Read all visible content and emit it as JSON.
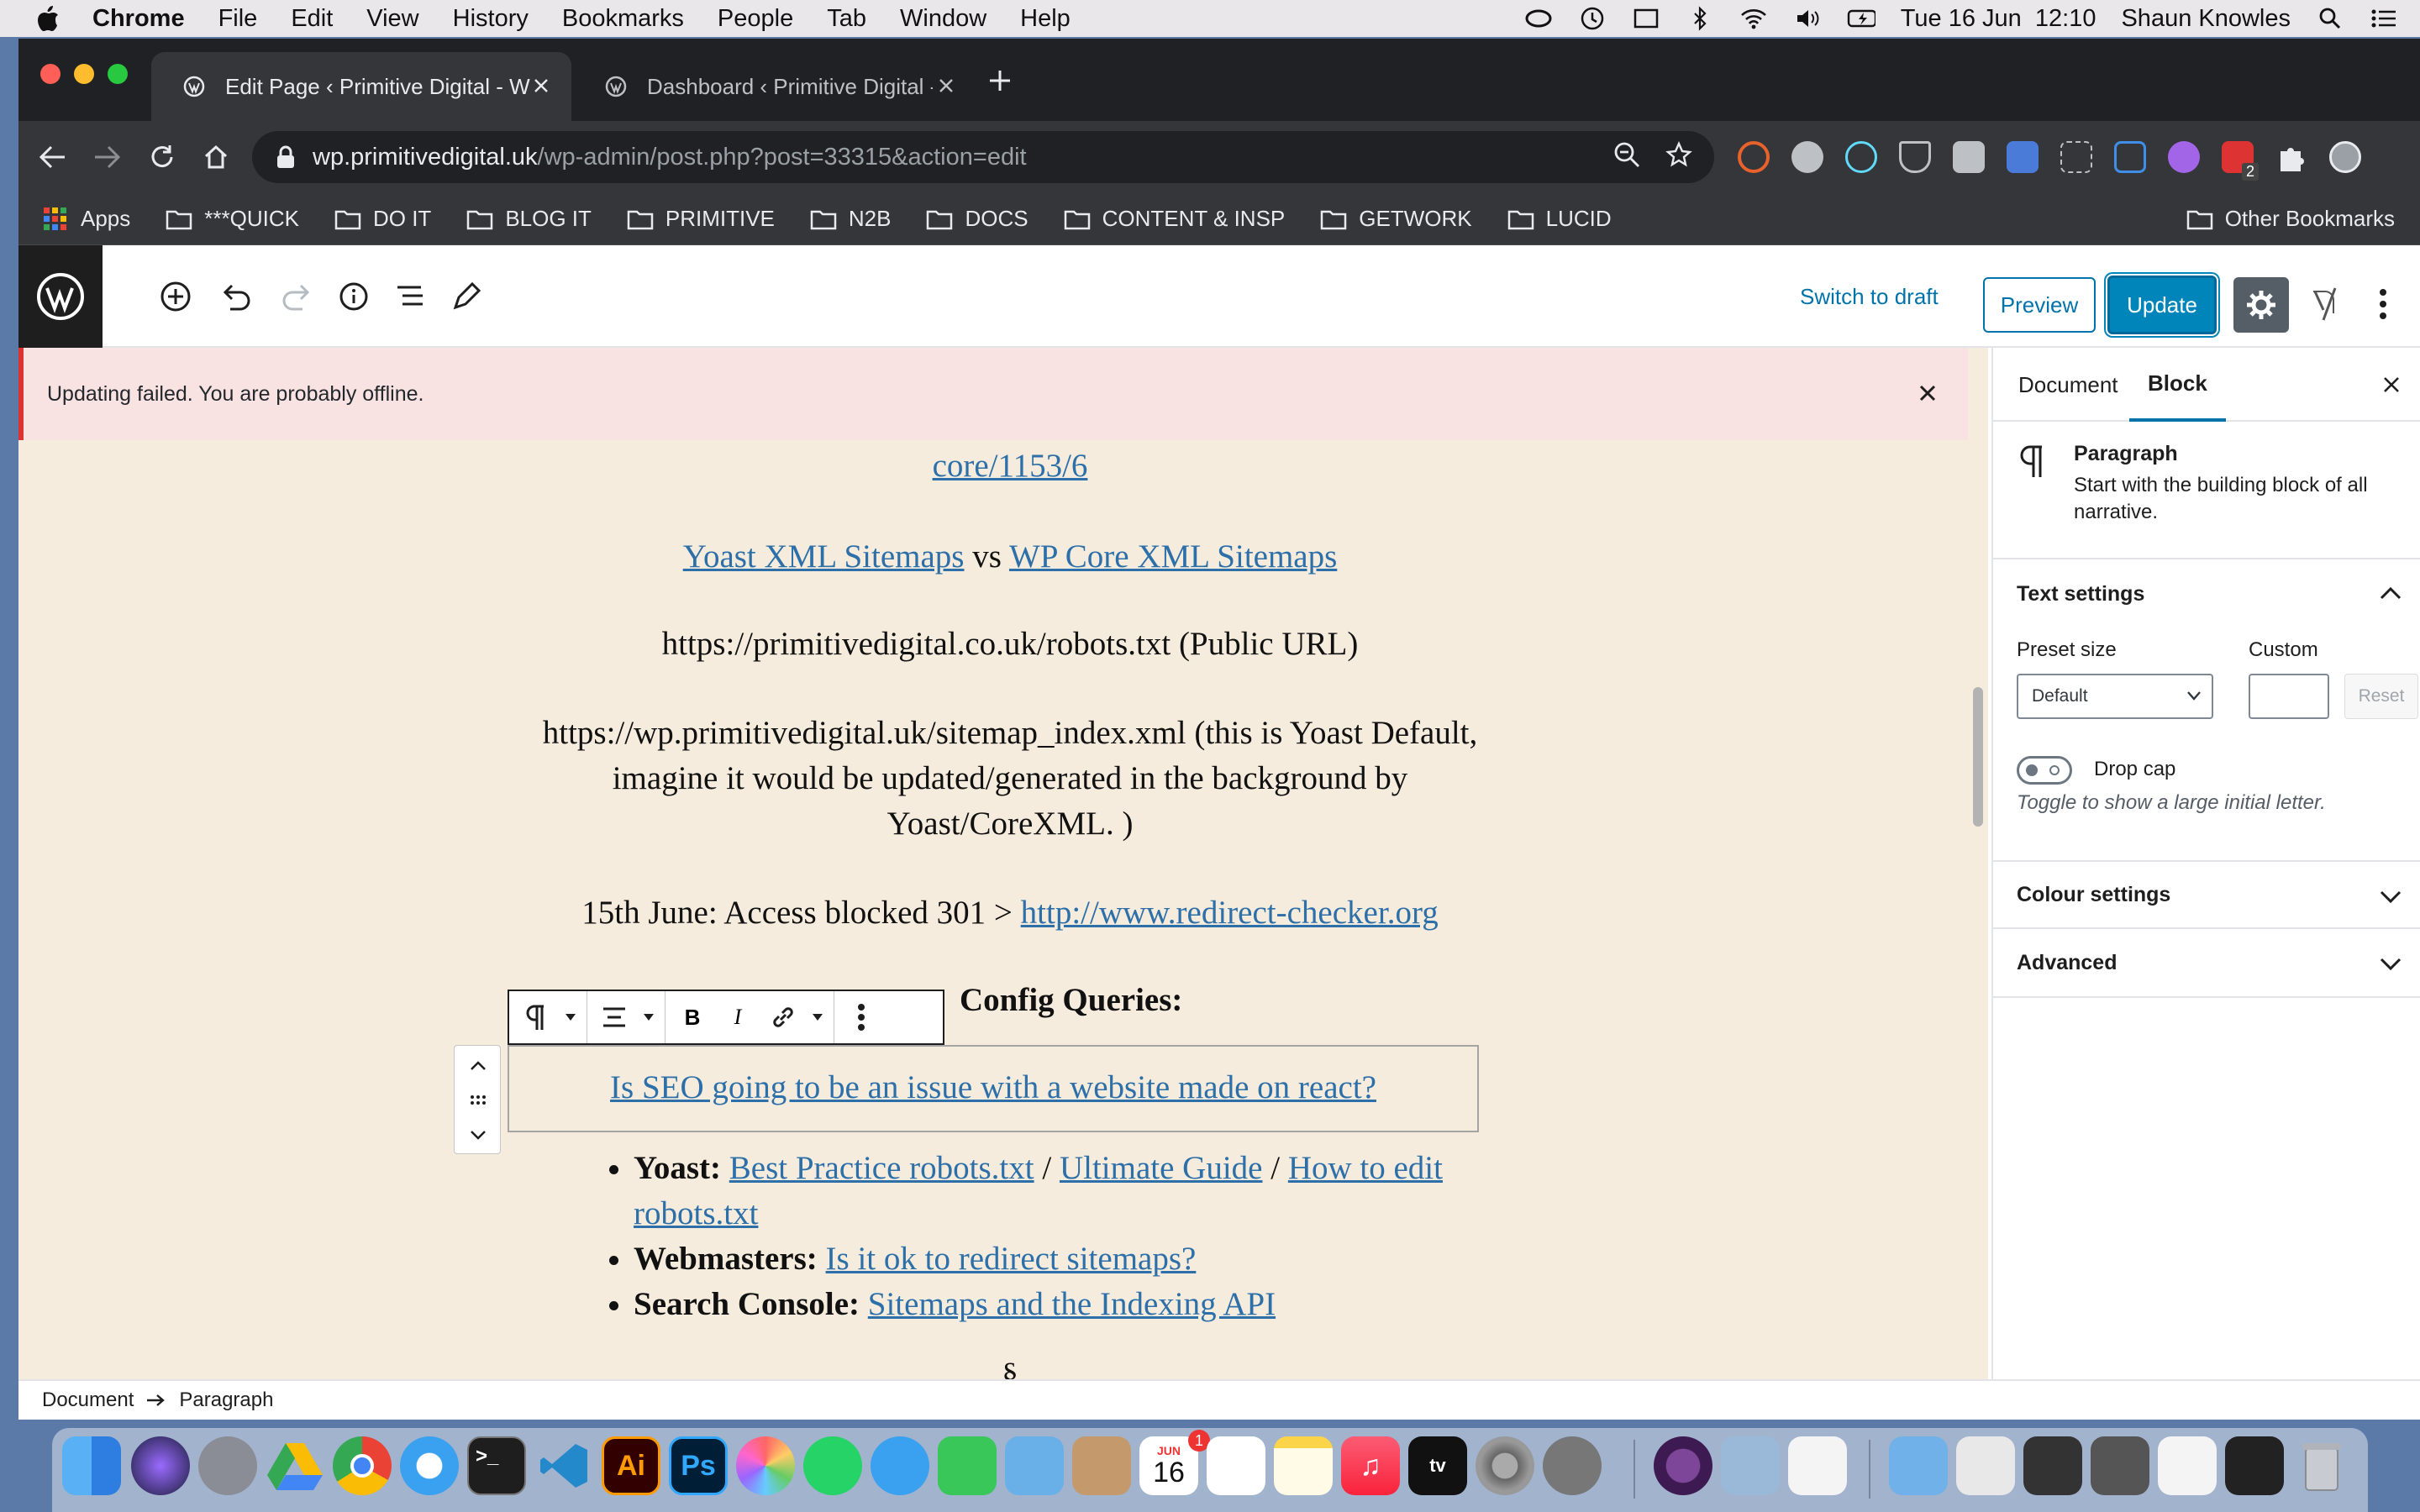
{
  "menubar": {
    "app": "Chrome",
    "items": [
      "File",
      "Edit",
      "View",
      "History",
      "Bookmarks",
      "People",
      "Tab",
      "Window",
      "Help"
    ],
    "clock": "Tue 16 Jun  12:10",
    "user": "Shaun Knowles"
  },
  "browser": {
    "tabs": [
      {
        "title": "Edit Page ‹ Primitive Digital - W",
        "active": true
      },
      {
        "title": "Dashboard ‹ Primitive Digital -",
        "active": false
      }
    ],
    "url_host": "wp.primitivedigital.uk",
    "url_path": "/wp-admin/post.php?post=33315&action=edit",
    "extension_badge": "2",
    "bookmarks": [
      "Apps",
      "***QUICK",
      "DO IT",
      "BLOG IT",
      "PRIMITIVE",
      "N2B",
      "DOCS",
      "CONTENT & INSP",
      "GETWORK",
      "LUCID"
    ],
    "other_bookmarks": "Other Bookmarks"
  },
  "editor": {
    "switch_to_draft": "Switch to draft",
    "preview": "Preview",
    "update": "Update",
    "notice": "Updating failed. You are probably offline.",
    "content": {
      "partial_link": "core/1153/6",
      "yoast_link": "Yoast XML Sitemaps",
      "vs": " vs ",
      "wpcore_link": "WP Core XML Sitemaps",
      "robots": "https://primitivedigital.co.uk/robots.txt (Public URL)",
      "sitemap": "https://wp.primitivedigital.uk/sitemap_index.xml (this is Yoast Default, imagine it would be updated/generated in the background by Yoast/CoreXML. )",
      "june_prefix": "15th June: Access blocked 301 > ",
      "redirect_link": "http://www.redirect-checker.org",
      "heading_visible": "Config Queries:",
      "selected_link": "Is SEO going to be an issue with a website made on react?",
      "list": [
        {
          "label": "Yoast:",
          "links": [
            "Best Practice robots.txt",
            "Ultimate Guide",
            "How to edit robots.txt"
          ]
        },
        {
          "label": "Webmasters:",
          "links": [
            "Is it ok to redirect sitemaps?"
          ]
        },
        {
          "label": "Search Console:",
          "links": [
            "Sitemaps and the Indexing API"
          ]
        }
      ],
      "separator": "§",
      "list_sep": " / "
    },
    "sidebar": {
      "tabs": [
        "Document",
        "Block"
      ],
      "active_tab": "Block",
      "block_name": "Paragraph",
      "block_desc": "Start with the building block of all narrative.",
      "text_settings": "Text settings",
      "preset_size_label": "Preset size",
      "custom_label": "Custom",
      "preset_value": "Default",
      "reset": "Reset",
      "drop_cap": "Drop cap",
      "drop_cap_help": "Toggle to show a large initial letter.",
      "colour_settings": "Colour settings",
      "advanced": "Advanced"
    },
    "breadcrumb": [
      "Document",
      "Paragraph"
    ]
  },
  "dock": {
    "calendar_day": "16",
    "calendar_month": "JUN",
    "calendar_badge": "1"
  },
  "colors": {
    "wp_blue": "#0085ba",
    "link": "#2d6fa8",
    "content_bg": "#f5ecdd",
    "notice_bg": "#f9e2e2"
  }
}
